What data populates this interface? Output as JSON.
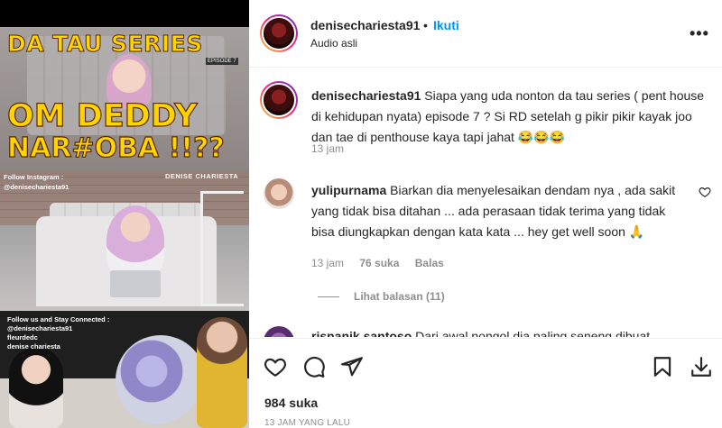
{
  "post": {
    "media": {
      "title_line1": "DA TAU SERIES",
      "episode_tag": "EPISODE 7",
      "title_line2": "OM DEDDY",
      "title_line3": "NAR#OBA !!??",
      "follow_instagram_line1": "Follow Instagram :",
      "follow_instagram_line2": "@denisechariesta91",
      "channel_logo": "DENISE CHARIESTA",
      "follow_stay_line1": "Follow us and Stay Connected :",
      "follow_stay_line2": "@denisechariesta91",
      "follow_stay_line3": "fleurdedc",
      "follow_stay_line4": "denise chariesta"
    },
    "header": {
      "username": "denisechariesta91",
      "separator": "•",
      "follow_label": "Ikuti",
      "audio_label": "Audio asli",
      "more_icon": "more-options-icon"
    },
    "caption": {
      "username": "denisechariesta91",
      "text": "Siapa yang uda nonton da tau series ( pent house di kehidupan nyata) episode 7 ? Si RD setelah g pikir pikir kayak joo dan tae di penthouse kaya tapi jahat 😂😂😂",
      "time": "13 jam"
    },
    "comments": [
      {
        "username": "yulipurnama",
        "text": "Biarkan dia menyelesaikan dendam nya , ada sakit yang tidak bisa ditahan ... ada perasaan tidak terima yang tidak bisa diungkapkan dengan kata kata ... hey get well soon 🙏",
        "time": "13 jam",
        "likes": "76 suka",
        "reply_label": "Balas",
        "view_replies": "Lihat balasan (11)"
      },
      {
        "username": "risnanik.santoso",
        "text": "Dari awal nongol dia paling seneng dibuat"
      }
    ],
    "footer": {
      "likes": "984 suka",
      "time": "13 JAM YANG LALU"
    }
  },
  "colors": {
    "link_blue": "#0095f6",
    "muted_text": "#8e8e8e",
    "title_yellow": "#ffd400"
  }
}
